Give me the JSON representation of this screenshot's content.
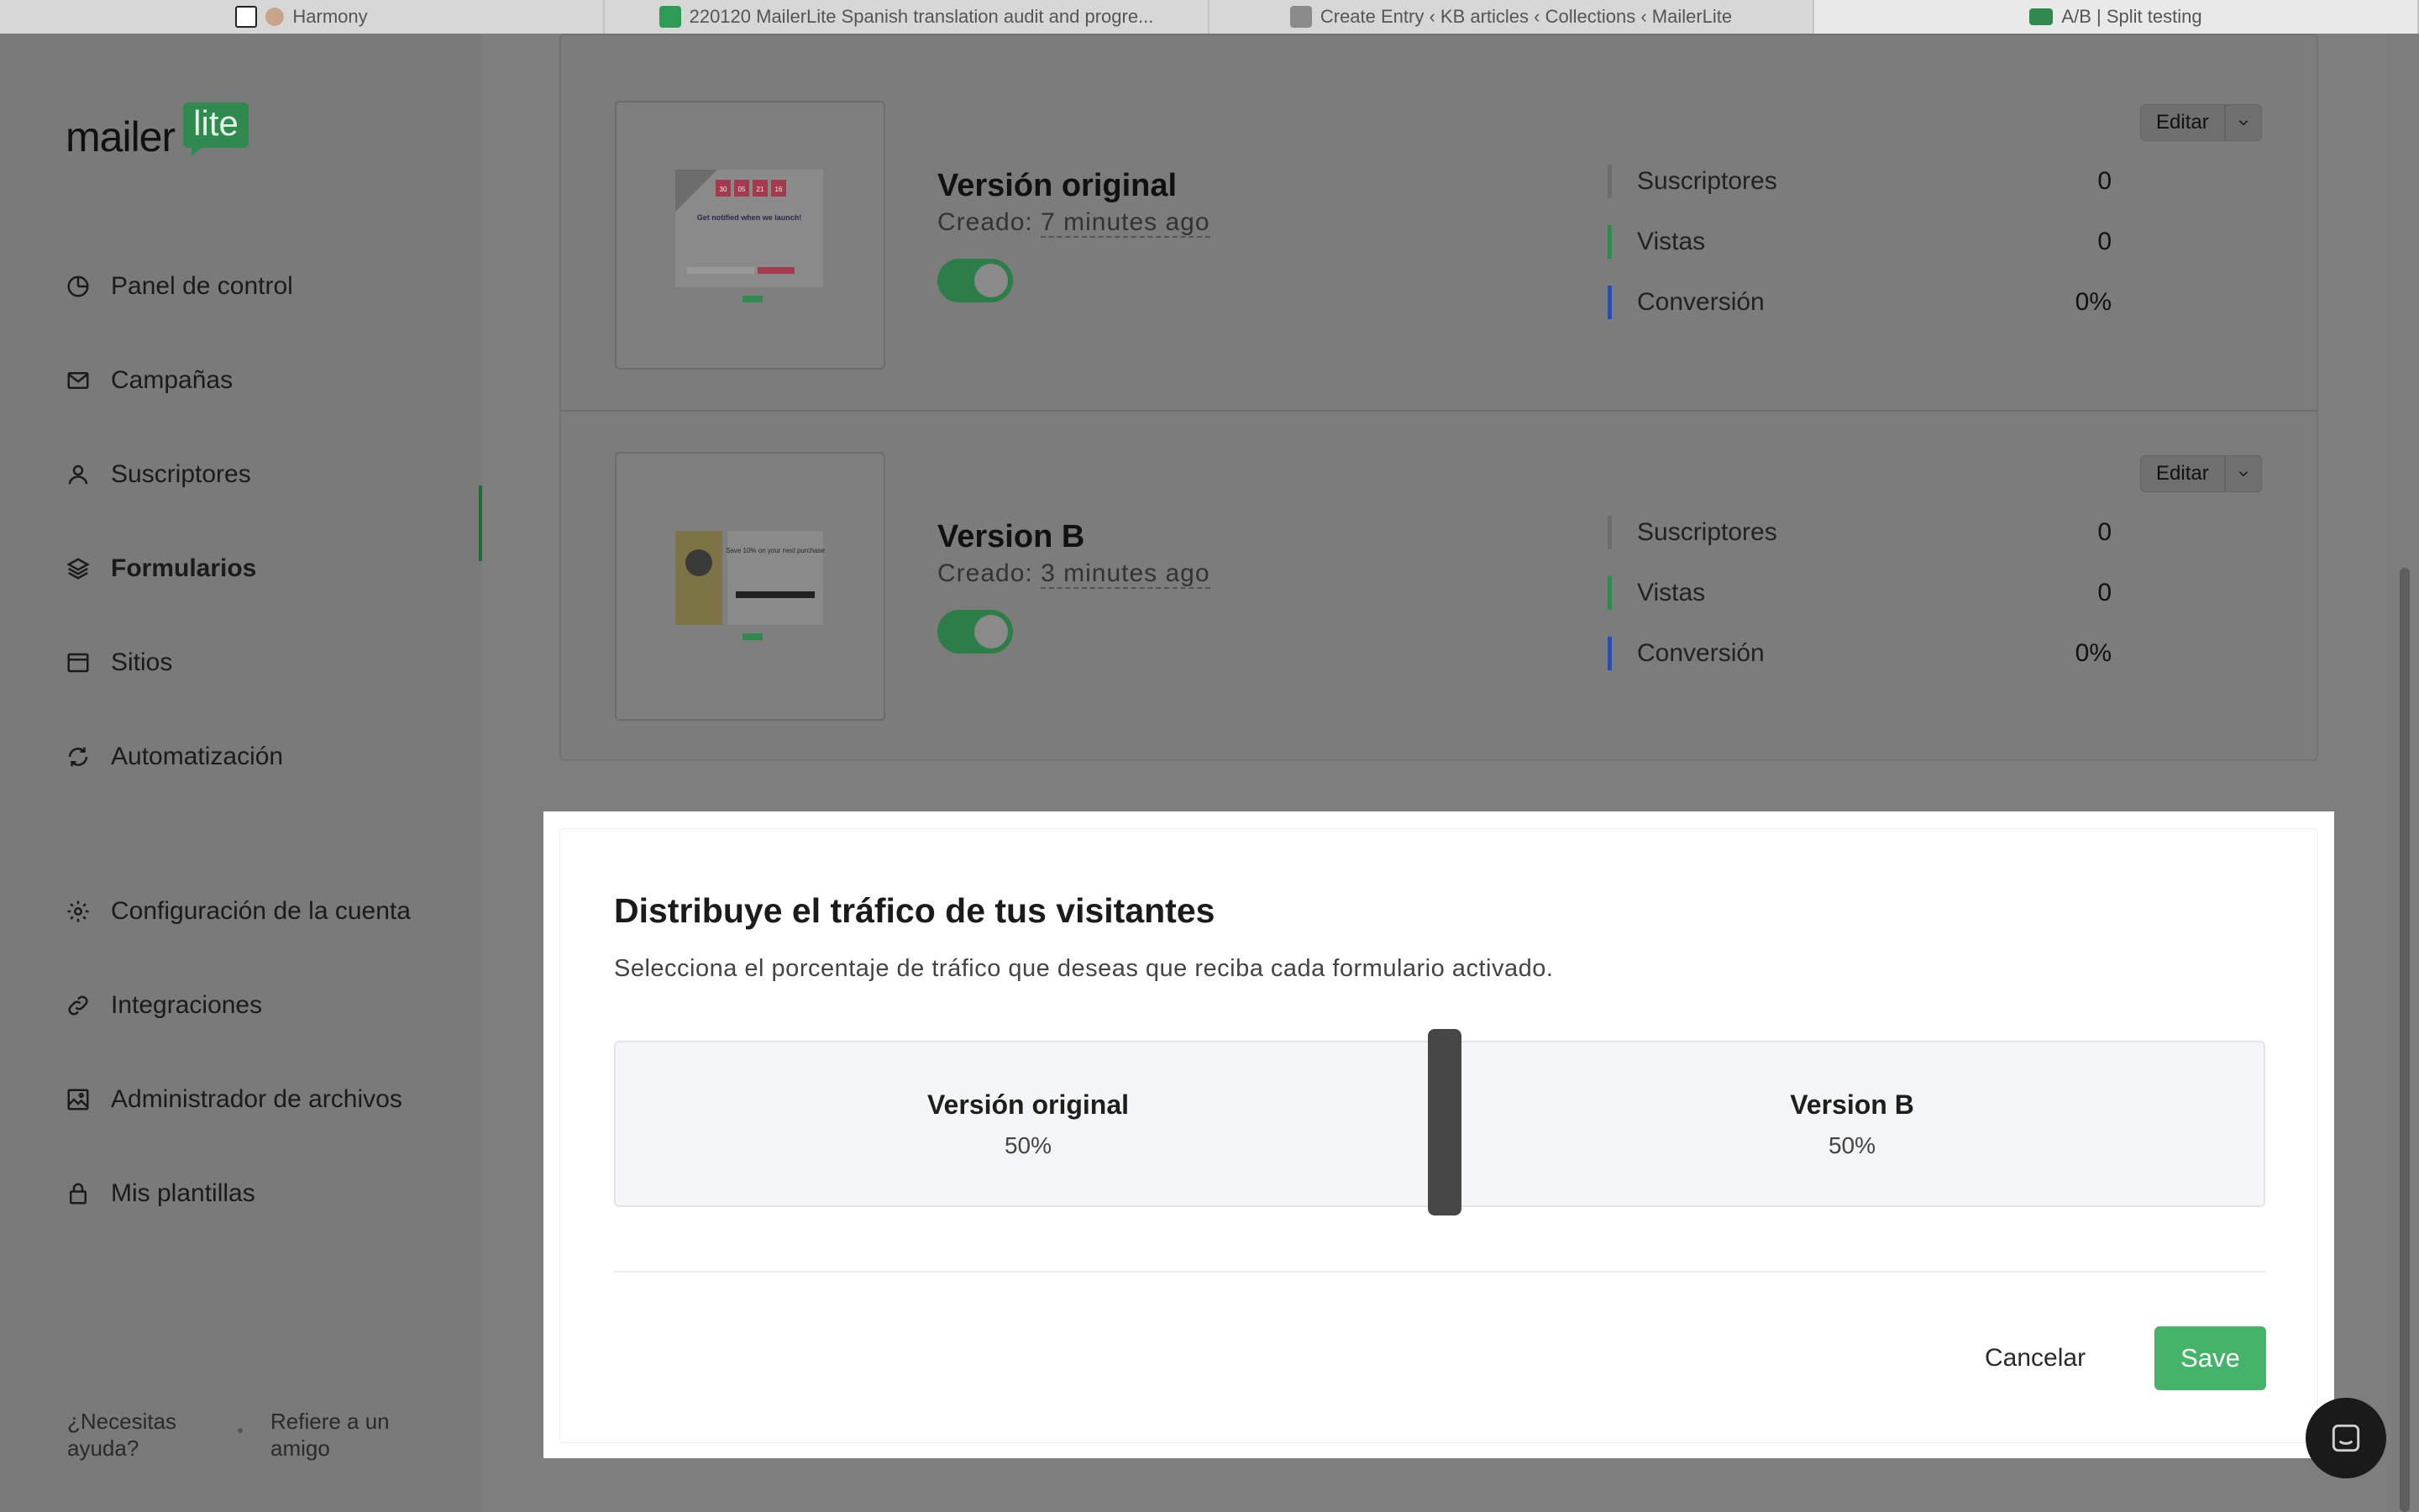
{
  "browser": {
    "tabs": [
      {
        "label": "Harmony",
        "active": false
      },
      {
        "label": "220120 MailerLite Spanish translation audit and progre...",
        "active": false
      },
      {
        "label": "Create Entry ‹ KB articles ‹ Collections ‹ MailerLite",
        "active": false
      },
      {
        "label": "A/B | Split testing",
        "active": true
      }
    ]
  },
  "sidebar": {
    "logo": {
      "word": "mailer",
      "badge": "lite"
    },
    "nav": [
      {
        "label": "Panel de control",
        "icon": "dashboard-icon"
      },
      {
        "label": "Campañas",
        "icon": "mail-icon"
      },
      {
        "label": "Suscriptores",
        "icon": "user-icon"
      },
      {
        "label": "Formularios",
        "icon": "layers-icon",
        "selected": true
      },
      {
        "label": "Sitios",
        "icon": "browser-icon"
      },
      {
        "label": "Automatización",
        "icon": "refresh-icon"
      }
    ],
    "nav_secondary": [
      {
        "label": "Configuración de la cuenta",
        "icon": "gear-icon"
      },
      {
        "label": "Integraciones",
        "icon": "link-icon"
      },
      {
        "label": "Administrador de archivos",
        "icon": "image-icon"
      },
      {
        "label": "Mis plantillas",
        "icon": "lock-icon"
      }
    ],
    "help": "¿Necesitas ayuda?",
    "refer": "Refiere a un amigo"
  },
  "versions": [
    {
      "title": "Versión original",
      "created_label": "Creado:",
      "created_ago": "7 minutes ago",
      "enabled": true,
      "edit": "Editar",
      "stats": [
        {
          "label": "Suscriptores",
          "value": "0",
          "color": "#6d6d6d"
        },
        {
          "label": "Vistas",
          "value": "0",
          "color": "#2f8a4f"
        },
        {
          "label": "Conversión",
          "value": "0%",
          "color": "#2a4bb0"
        }
      ]
    },
    {
      "title": "Version B",
      "created_label": "Creado:",
      "created_ago": "3 minutes ago",
      "enabled": true,
      "edit": "Editar",
      "stats": [
        {
          "label": "Suscriptores",
          "value": "0",
          "color": "#6d6d6d"
        },
        {
          "label": "Vistas",
          "value": "0",
          "color": "#2f8a4f"
        },
        {
          "label": "Conversión",
          "value": "0%",
          "color": "#2a4bb0"
        }
      ]
    }
  ],
  "modal": {
    "title": "Distribuye el tráfico de tus visitantes",
    "subtitle": "Selecciona el porcentaje de tráfico que deseas que reciba cada formulario activado.",
    "split": [
      {
        "name": "Versión original",
        "percent": "50%"
      },
      {
        "name": "Version B",
        "percent": "50%"
      }
    ],
    "cancel": "Cancelar",
    "save": "Save",
    "save_color": "#46b36a"
  },
  "thumb1": {
    "countdown": [
      "30",
      "05",
      "21",
      "16"
    ],
    "headline": "Get notified when we launch!"
  },
  "thumb2": {
    "headline": "Save 10% on your next purchase"
  }
}
